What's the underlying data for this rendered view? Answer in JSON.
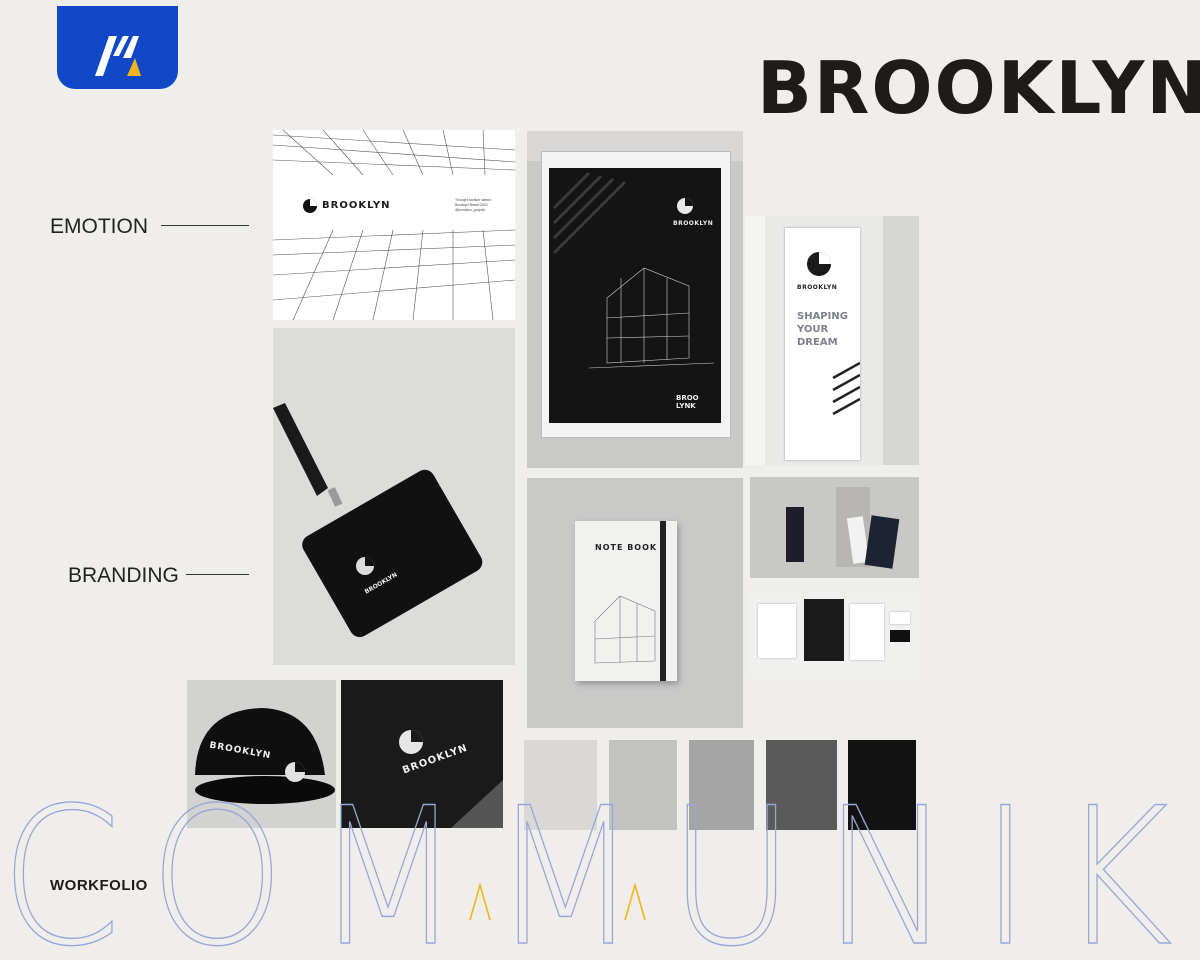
{
  "brand": {
    "title": "BROOKLYN",
    "logo_name": "mk-logo-icon",
    "accent_color": "#1148c8",
    "accent_yellow": "#f3b51b"
  },
  "labels": {
    "emotion": "EMOTION",
    "branding": "BRANDING",
    "workfolio": "WORKFOLIO"
  },
  "watermark": {
    "text": "COMMUNIK"
  },
  "mockups": {
    "sketch_card_brand": "BROOKLYN",
    "sketch_card_tagline_1": "Thought scratch sketch",
    "sketch_card_tagline_2": "Brooklyn Brand 2022",
    "sketch_card_tagline_3": "@brooklyn_graphic",
    "poster_brand": "BROOKLYN",
    "poster_brand_short_1": "BROO",
    "poster_brand_short_2": "LYNK",
    "banner_brand": "BROOKLYN",
    "banner_slogan_1": "SHAPING",
    "banner_slogan_2": "YOUR",
    "banner_slogan_3": "DREAM",
    "badge_brand": "BROOKLYN",
    "notebook_title": "NOTE BOOK",
    "helmet_brand": "BROOKLYN",
    "card_brand": "BROOKLYN"
  },
  "palette": [
    "#d9d8d7",
    "#c2c2c1",
    "#a5a5a5",
    "#5a5a5a",
    "#121212"
  ]
}
